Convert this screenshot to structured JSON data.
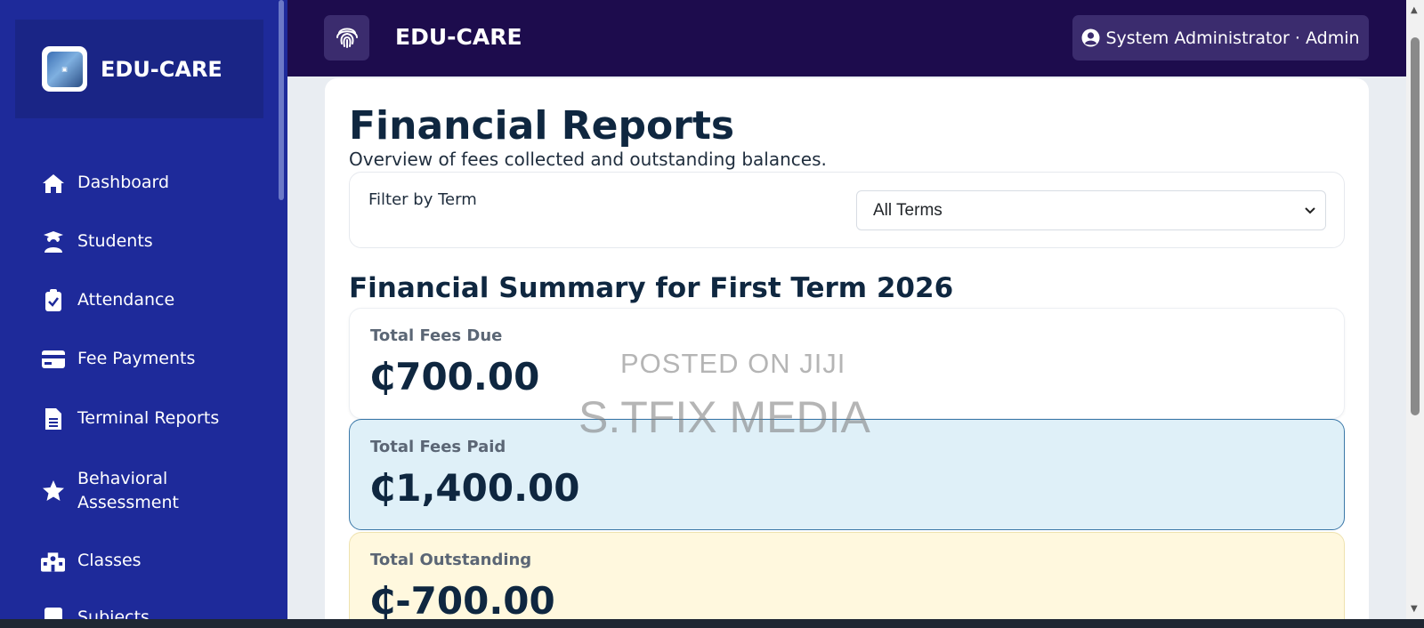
{
  "sidebar": {
    "brand_title": "EDU-CARE",
    "items": [
      {
        "label": "Dashboard",
        "icon": "home-icon"
      },
      {
        "label": "Students",
        "icon": "student-icon"
      },
      {
        "label": "Attendance",
        "icon": "clipboard-check-icon"
      },
      {
        "label": "Fee Payments",
        "icon": "credit-card-icon"
      },
      {
        "label": "Terminal Reports",
        "icon": "file-text-icon"
      },
      {
        "label": "Behavioral",
        "label2": "Assessment",
        "icon": "star-icon"
      },
      {
        "label": "Classes",
        "icon": "school-icon"
      },
      {
        "label": "Subjects",
        "icon": "book-icon"
      }
    ]
  },
  "topbar": {
    "title": "EDU-CARE",
    "fingerprint_icon": "fingerprint-icon",
    "user_label": "System Administrator · Admin",
    "user_icon": "user-circle-icon"
  },
  "main": {
    "title": "Financial Reports",
    "subtitle": "Overview of fees collected and outstanding balances.",
    "filter": {
      "label": "Filter by Term",
      "selected": "All Terms"
    },
    "summary_title": "Financial Summary for First Term 2026",
    "stats": {
      "due": {
        "label": "Total Fees Due",
        "value": "₵700.00"
      },
      "paid": {
        "label": "Total Fees Paid",
        "value": "₵1,400.00"
      },
      "outstanding": {
        "label": "Total Outstanding",
        "value": "₵-700.00"
      }
    }
  },
  "watermark": {
    "line1": "POSTED ON JIJI",
    "line2": "S.TFIX MEDIA"
  },
  "colors": {
    "sidebar_bg": "#1e2a9a",
    "topbar_bg": "#1d0c4d",
    "accent_paid": "#dff0f8",
    "accent_outstanding": "#fff8de",
    "heading": "#0f2740"
  }
}
